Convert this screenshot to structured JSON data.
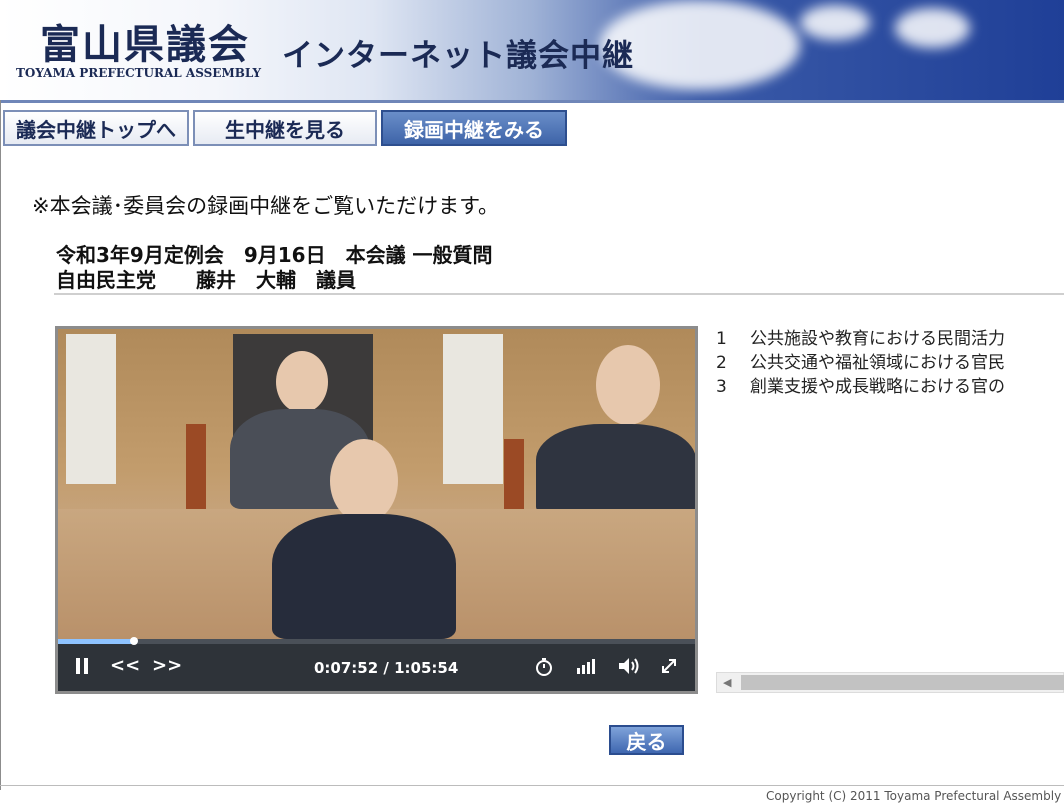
{
  "header": {
    "title": "富山県議会",
    "title_en": "TOYAMA PREFECTURAL ASSEMBLY",
    "subtitle": "インターネット議会中継"
  },
  "nav": {
    "items": [
      {
        "label": "議会中継トップへ",
        "active": false
      },
      {
        "label": "生中継を見る",
        "active": false
      },
      {
        "label": "録画中継をみる",
        "active": true
      }
    ]
  },
  "notice": "※本会議･委員会の録画中継をご覧いただけます。",
  "meeting": {
    "session": "令和3年9月定例会　9月16日　本会議 一般質問",
    "speaker": "自由民主党　　藤井　大輔　議員"
  },
  "player": {
    "current_time": "0:07:52",
    "duration": "1:05:54",
    "time_display": "0:07:52 / 1:05:54",
    "progress_fraction": 0.119,
    "controls": {
      "pause": "pause-icon",
      "rewind": "<<",
      "forward": ">>",
      "timer": "timer-icon",
      "quality": "quality-icon",
      "volume": "volume-icon",
      "fullscreen": "fullscreen-icon"
    }
  },
  "agenda": {
    "items": [
      {
        "num": "1",
        "text": "公共施設や教育における民間活力"
      },
      {
        "num": "2",
        "text": "公共交通や福祉領域における官民"
      },
      {
        "num": "3",
        "text": "創業支援や成長戦略における官の"
      }
    ]
  },
  "back_button": "戻る",
  "footer": {
    "copyright": "Copyright (C) 2011  Toyama Prefectural Assembly"
  },
  "colors": {
    "banner_dark": "#1f3f97",
    "nav_active": "#3e64a8",
    "player_bar": "#2e3339",
    "progress": "#8ec3ff"
  }
}
